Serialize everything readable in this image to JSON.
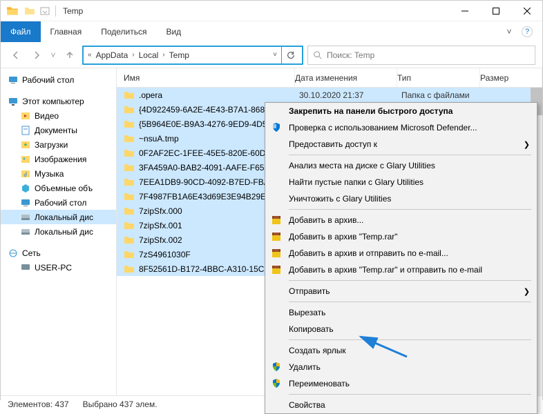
{
  "title": "Temp",
  "ribbon": {
    "file": "Файл",
    "home": "Главная",
    "share": "Поделиться",
    "view": "Вид"
  },
  "address": {
    "segments": [
      "AppData",
      "Local",
      "Temp"
    ]
  },
  "search": {
    "placeholder": "Поиск: Temp"
  },
  "tree": [
    {
      "label": "Рабочий стол",
      "icon": "desktop",
      "lvl": 1
    },
    {
      "spacer": true
    },
    {
      "label": "Этот компьютер",
      "icon": "pc",
      "lvl": 1
    },
    {
      "label": "Видео",
      "icon": "video",
      "lvl": 2
    },
    {
      "label": "Документы",
      "icon": "docs",
      "lvl": 2
    },
    {
      "label": "Загрузки",
      "icon": "down",
      "lvl": 2
    },
    {
      "label": "Изображения",
      "icon": "img",
      "lvl": 2
    },
    {
      "label": "Музыка",
      "icon": "music",
      "lvl": 2
    },
    {
      "label": "Объемные объ",
      "icon": "3d",
      "lvl": 2
    },
    {
      "label": "Рабочий стол",
      "icon": "desktop",
      "lvl": 2
    },
    {
      "label": "Локальный дис",
      "icon": "disk",
      "lvl": 2,
      "sel": true
    },
    {
      "label": "Локальный дис",
      "icon": "disk",
      "lvl": 2
    },
    {
      "spacer": true
    },
    {
      "label": "Сеть",
      "icon": "net",
      "lvl": 1
    },
    {
      "label": "USER-PC",
      "icon": "pc2",
      "lvl": 2
    }
  ],
  "columns": {
    "name": "Имя",
    "date": "Дата изменения",
    "type": "Тип",
    "size": "Размер"
  },
  "rows": [
    {
      "name": ".opera",
      "date": "30.10.2020 21:37",
      "type": "Папка с файлами"
    },
    {
      "name": "{4D922459-6A2E-4E43-B7A1-8687"
    },
    {
      "name": "{5B964E0E-B9A3-4276-9ED9-4D5A"
    },
    {
      "name": "~nsuA.tmp"
    },
    {
      "name": "0F2AF2EC-1FEE-45E5-820E-60DBF"
    },
    {
      "name": "3FA459A0-BAB2-4091-AAFE-F65D"
    },
    {
      "name": "7EEA1DB9-90CD-4092-B7ED-FBA"
    },
    {
      "name": "7F4987FB1A6E43d69E3E94B29EB7"
    },
    {
      "name": "7zipSfx.000"
    },
    {
      "name": "7zipSfx.001"
    },
    {
      "name": "7zipSfx.002"
    },
    {
      "name": "7zS4961030F"
    },
    {
      "name": "8F52561D-B172-4BBC-A310-15C9"
    }
  ],
  "status": {
    "count": "Элементов: 437",
    "selected": "Выбрано 437 элем."
  },
  "context": [
    {
      "label": "Закрепить на панели быстрого доступа",
      "bold": true
    },
    {
      "label": "Проверка с использованием Microsoft Defender...",
      "icon": "shield-blue"
    },
    {
      "label": "Предоставить доступ к",
      "sub": true
    },
    {
      "sep": true
    },
    {
      "label": "Анализ места на диске с Glary Utilities"
    },
    {
      "label": "Найти пустые папки с Glary Utilities"
    },
    {
      "label": "Уничтожить с Glary Utilities"
    },
    {
      "sep": true
    },
    {
      "label": "Добавить в архив...",
      "icon": "rar"
    },
    {
      "label": "Добавить в архив \"Temp.rar\"",
      "icon": "rar"
    },
    {
      "label": "Добавить в архив и отправить по e-mail...",
      "icon": "rar"
    },
    {
      "label": "Добавить в архив \"Temp.rar\" и отправить по e-mail",
      "icon": "rar"
    },
    {
      "sep": true
    },
    {
      "label": "Отправить",
      "sub": true
    },
    {
      "sep": true
    },
    {
      "label": "Вырезать"
    },
    {
      "label": "Копировать"
    },
    {
      "sep": true
    },
    {
      "label": "Создать ярлык"
    },
    {
      "label": "Удалить",
      "icon": "uac"
    },
    {
      "label": "Переименовать",
      "icon": "uac"
    },
    {
      "sep": true
    },
    {
      "label": "Свойства"
    }
  ]
}
